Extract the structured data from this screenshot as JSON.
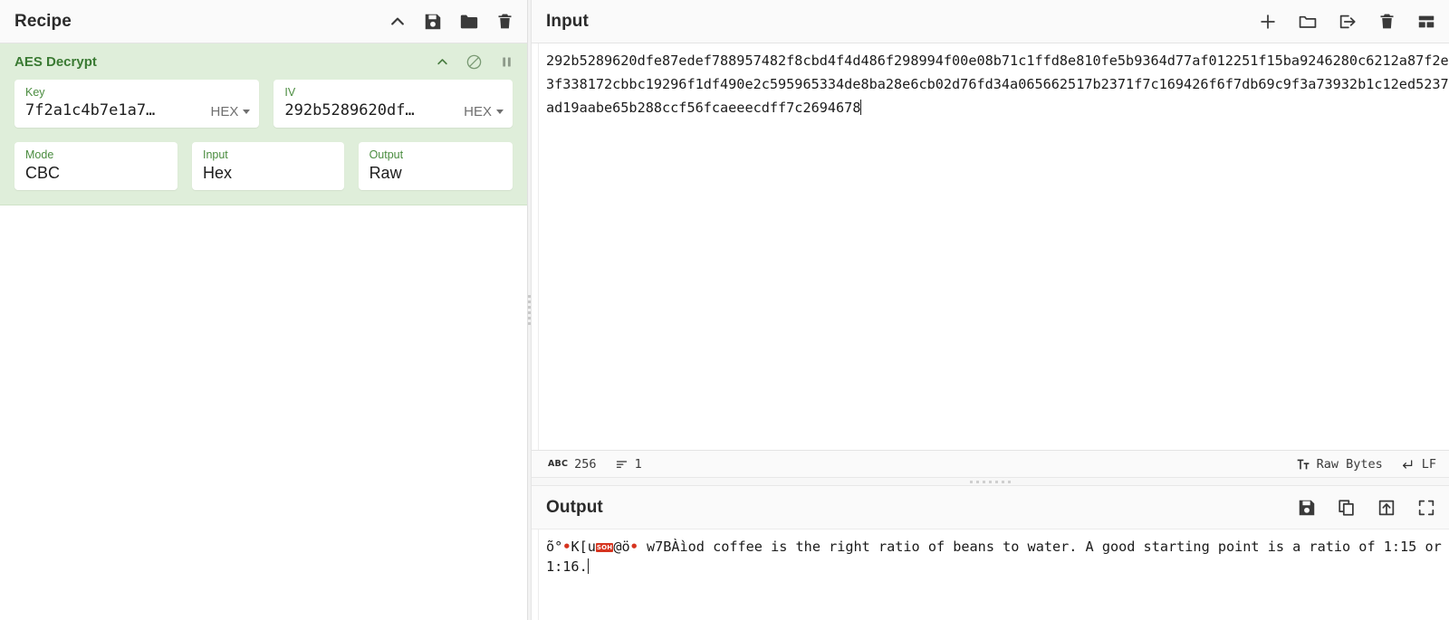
{
  "recipe": {
    "title": "Recipe",
    "actions": [
      {
        "name": "collapse-recipe-button",
        "icon": "chevron-up-icon"
      },
      {
        "name": "save-recipe-button",
        "icon": "save-icon"
      },
      {
        "name": "load-recipe-button",
        "icon": "folder-icon"
      },
      {
        "name": "clear-recipe-button",
        "icon": "trash-icon"
      }
    ],
    "operation": {
      "title": "AES Decrypt",
      "actions": [
        {
          "name": "op-collapse-button",
          "icon": "chevron-up-icon"
        },
        {
          "name": "op-disable-button",
          "icon": "disable-icon"
        },
        {
          "name": "op-breakpoint-button",
          "icon": "pause-icon"
        }
      ],
      "fields": {
        "key": {
          "label": "Key",
          "value": "7f2a1c4b7e1a7…",
          "unit": "HEX"
        },
        "iv": {
          "label": "IV",
          "value": "292b5289620df…",
          "unit": "HEX"
        },
        "mode": {
          "label": "Mode",
          "value": "CBC"
        },
        "input": {
          "label": "Input",
          "value": "Hex"
        },
        "output": {
          "label": "Output",
          "value": "Raw"
        }
      }
    }
  },
  "input": {
    "title": "Input",
    "actions": [
      {
        "name": "add-input-tab-button",
        "icon": "plus-icon"
      },
      {
        "name": "open-folder-as-input-button",
        "icon": "folder-outline-icon"
      },
      {
        "name": "open-file-as-input-button",
        "icon": "arrow-into-box-icon"
      },
      {
        "name": "clear-input-button",
        "icon": "trash-icon"
      },
      {
        "name": "input-layout-button",
        "icon": "layout-grid-icon"
      }
    ],
    "value": "292b5289620dfe87edef788957482f8cbd4f4d486f298994f00e08b71c1ffd8e810fe5b9364d77af012251f15ba9246280c6212a87f2e3f338172cbbc19296f1df490e2c595965334de8ba28e6cb02d76fd34a065662517b2371f7c169426f6f7db69c9f3a73932b1c12ed5237ad19aabe65b288ccf56fcaeeecdff7c2694678",
    "status": {
      "length_icon": "abc-icon",
      "length": "256",
      "lines_icon": "lines-icon",
      "lines": "1",
      "encoding_icon": "font-size-icon",
      "encoding": "Raw Bytes",
      "eol_icon": "return-arrow-icon",
      "eol": "LF"
    }
  },
  "output": {
    "title": "Output",
    "actions": [
      {
        "name": "save-output-button",
        "icon": "save-icon"
      },
      {
        "name": "copy-output-button",
        "icon": "copy-icon"
      },
      {
        "name": "replace-input-with-output-button",
        "icon": "box-up-arrow-icon"
      },
      {
        "name": "maximise-output-button",
        "icon": "fullscreen-icon"
      }
    ],
    "value_prefix": "õ°",
    "value_mid1": "K[u",
    "value_ctrl": "SOH",
    "value_mid2": "@ö",
    "value_rest": " w7BÀìod coffee is the right ratio of beans to water. A good starting point is a ratio of 1:15 or 1:16."
  },
  "colors": {
    "op_bg": "#dfeeda",
    "op_accent": "#3a7a33",
    "label_green": "#4a8c3f",
    "header_bg": "#fafafa",
    "control_char": "#d6341f"
  }
}
